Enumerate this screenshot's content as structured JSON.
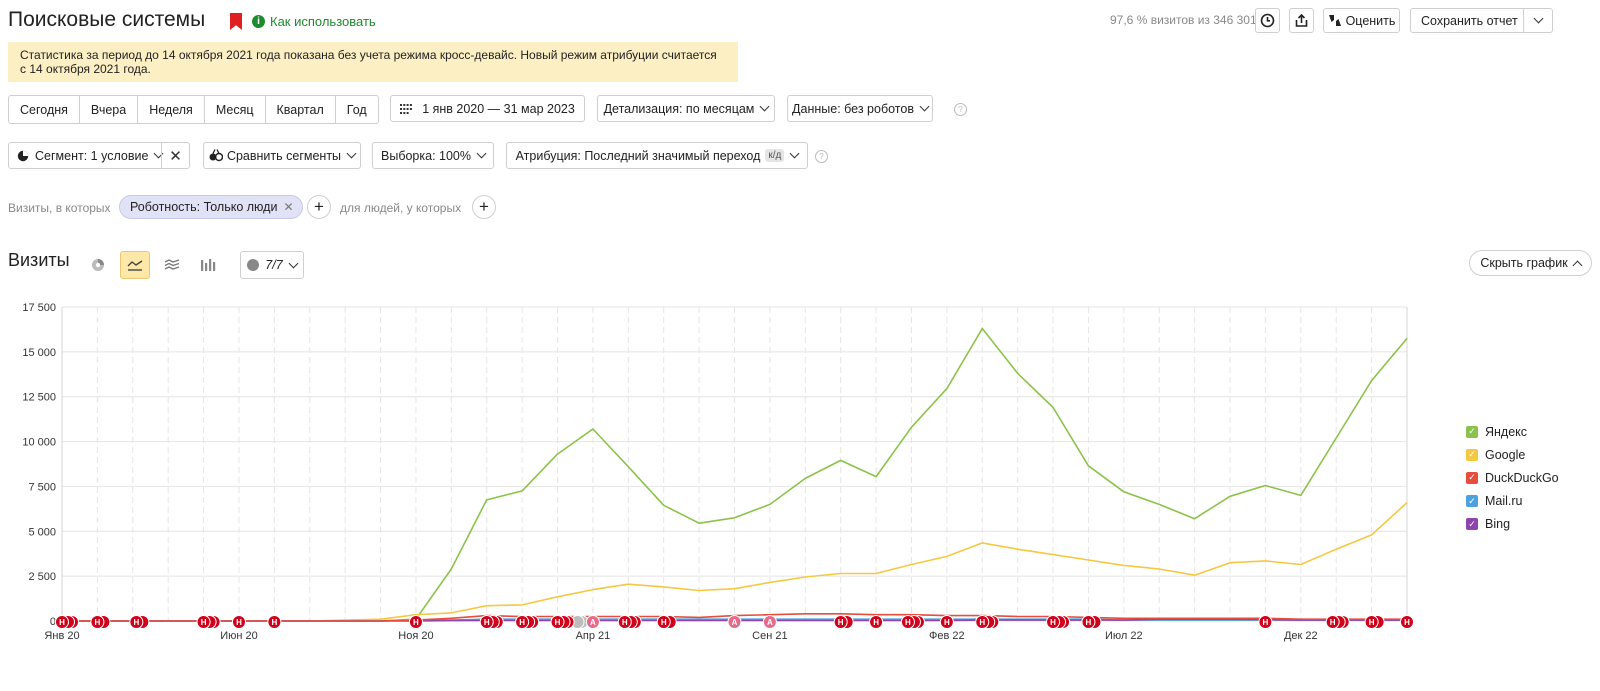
{
  "header": {
    "title": "Поисковые системы",
    "how_to_use": "Как использовать",
    "visits_share": "97,6 % визитов из 346 301",
    "rate_label": "Оценить",
    "save_report_label": "Сохранить отчет"
  },
  "banner": {
    "text": "Статистика за период до 14 октября 2021 года показана без учета режима кросс-девайс. Новый режим атрибуции считается с 14 октября 2021 года."
  },
  "period": {
    "options": [
      "Сегодня",
      "Вчера",
      "Неделя",
      "Месяц",
      "Квартал",
      "Год"
    ],
    "date_range": "1 янв 2020 — 31 мар 2023",
    "detail": "Детализация: по месяцам",
    "data": "Данные: без роботов"
  },
  "segment": {
    "segment_label": "Сегмент: 1 условие",
    "compare_label": "Сравнить сегменты",
    "sample_label": "Выборка: 100%",
    "attribution_label": "Атрибуция: Последний значимый переход",
    "attribution_badge": "к/д"
  },
  "filters": {
    "visits_label": "Визиты, в которых",
    "chip_label": "Роботность: Только люди",
    "people_label": "для людей, у которых"
  },
  "chart_header": {
    "title": "Визиты",
    "annotations_count": "7/7",
    "hide_chart_label": "Скрыть график"
  },
  "colors": {
    "yandex": "#8bc34a",
    "google": "#f5c842",
    "duckduckgo": "#e74c3c",
    "mailru": "#4aa3df",
    "bing": "#8e44ad",
    "marker_h": "#d0021b",
    "marker_a": "#e86a8a"
  },
  "chart_data": {
    "type": "line",
    "x": [
      "Янв 20",
      "Фев 20",
      "Мар 20",
      "Апр 20",
      "Май 20",
      "Июн 20",
      "Июл 20",
      "Авг 20",
      "Сен 20",
      "Окт 20",
      "Ноя 20",
      "Дек 20",
      "Янв 21",
      "Фев 21",
      "Мар 21",
      "Апр 21",
      "Май 21",
      "Июн 21",
      "Июл 21",
      "Авг 21",
      "Сен 21",
      "Окт 21",
      "Ноя 21",
      "Дек 21",
      "Янв 22",
      "Фев 22",
      "Мар 22",
      "Апр 22",
      "Май 22",
      "Июн 22",
      "Июл 22",
      "Авг 22",
      "Сен 22",
      "Окт 22",
      "Ноя 22",
      "Дек 22",
      "Янв 23",
      "Фев 23",
      "Мар 23"
    ],
    "x_tick_labels": [
      "Янв 20",
      "Июн 20",
      "Ноя 20",
      "Апр 21",
      "Сен 21",
      "Фев 22",
      "Июл 22",
      "Дек 22"
    ],
    "ylim": [
      0,
      17500
    ],
    "y_ticks": [
      "0",
      "2 500",
      "5 000",
      "7 500",
      "10 000",
      "12 500",
      "15 000",
      "17 500"
    ],
    "series": [
      {
        "name": "Яндекс",
        "values": [
          0,
          0,
          0,
          0,
          0,
          0,
          0,
          0,
          0,
          0,
          100,
          2900,
          6750,
          7250,
          9300,
          10700,
          8600,
          6450,
          5450,
          5750,
          6500,
          7950,
          8950,
          8050,
          10800,
          12950,
          16300,
          13800,
          11900,
          8650,
          7200,
          6500,
          5700,
          6950,
          7550,
          7000,
          10200,
          13400,
          15750
        ]
      },
      {
        "name": "Google",
        "values": [
          0,
          0,
          0,
          0,
          0,
          0,
          0,
          0,
          50,
          100,
          350,
          450,
          850,
          900,
          1350,
          1750,
          2050,
          1900,
          1700,
          1800,
          2150,
          2450,
          2650,
          2650,
          3150,
          3600,
          4350,
          4000,
          3700,
          3400,
          3100,
          2900,
          2550,
          3250,
          3350,
          3150,
          4000,
          4800,
          6600
        ]
      },
      {
        "name": "DuckDuckGo",
        "values": [
          0,
          0,
          0,
          0,
          0,
          0,
          0,
          0,
          0,
          0,
          50,
          150,
          300,
          250,
          250,
          250,
          250,
          250,
          200,
          300,
          350,
          400,
          400,
          350,
          350,
          300,
          300,
          250,
          250,
          200,
          150,
          150,
          150,
          150,
          150,
          100,
          100,
          100,
          100
        ]
      },
      {
        "name": "Mail.ru",
        "values": [
          0,
          0,
          0,
          0,
          0,
          0,
          0,
          0,
          0,
          0,
          50,
          50,
          100,
          100,
          100,
          100,
          100,
          100,
          100,
          100,
          100,
          100,
          100,
          100,
          100,
          100,
          100,
          100,
          100,
          100,
          50,
          50,
          50,
          50,
          50,
          50,
          50,
          50,
          50
        ]
      },
      {
        "name": "Bing",
        "values": [
          0,
          0,
          0,
          0,
          0,
          0,
          0,
          0,
          0,
          0,
          0,
          20,
          30,
          30,
          30,
          30,
          30,
          30,
          30,
          30,
          30,
          30,
          30,
          30,
          30,
          30,
          50,
          50,
          50,
          50,
          50,
          100,
          100,
          100,
          80,
          50,
          50,
          50,
          50
        ]
      }
    ],
    "markers": [
      {
        "x": 0.0,
        "label": "Н",
        "count": 3
      },
      {
        "x": 1.0,
        "label": "Н",
        "count": 2
      },
      {
        "x": 2.1,
        "label": "Н",
        "count": 2
      },
      {
        "x": 4.0,
        "label": "Н",
        "count": 3
      },
      {
        "x": 5.0,
        "label": "Н",
        "count": 1
      },
      {
        "x": 6.0,
        "label": "Н",
        "count": 1
      },
      {
        "x": 10.0,
        "label": "Н",
        "count": 1
      },
      {
        "x": 12.0,
        "label": "Н",
        "count": 3
      },
      {
        "x": 13.0,
        "label": "Н",
        "count": 3
      },
      {
        "x": 14.0,
        "label": "Н",
        "count": 3,
        "extra_grey": 2
      },
      {
        "x": 15.0,
        "label": "А",
        "count": 1
      },
      {
        "x": 15.9,
        "label": "Н",
        "count": 3
      },
      {
        "x": 17.0,
        "label": "Н",
        "count": 2
      },
      {
        "x": 19.0,
        "label": "А",
        "count": 1
      },
      {
        "x": 20.0,
        "label": "А",
        "count": 1
      },
      {
        "x": 22.0,
        "label": "Н",
        "count": 2
      },
      {
        "x": 23.0,
        "label": "Н",
        "count": 1
      },
      {
        "x": 23.9,
        "label": "Н",
        "count": 3
      },
      {
        "x": 25.0,
        "label": "Н",
        "count": 1
      },
      {
        "x": 26.0,
        "label": "Н",
        "count": 3
      },
      {
        "x": 28.0,
        "label": "Н",
        "count": 3
      },
      {
        "x": 29.0,
        "label": "Н",
        "count": 2
      },
      {
        "x": 34.0,
        "label": "Н",
        "count": 1
      },
      {
        "x": 35.9,
        "label": "Н",
        "count": 3
      },
      {
        "x": 37.0,
        "label": "Н",
        "count": 2
      },
      {
        "x": 38.0,
        "label": "Н",
        "count": 1
      }
    ]
  }
}
